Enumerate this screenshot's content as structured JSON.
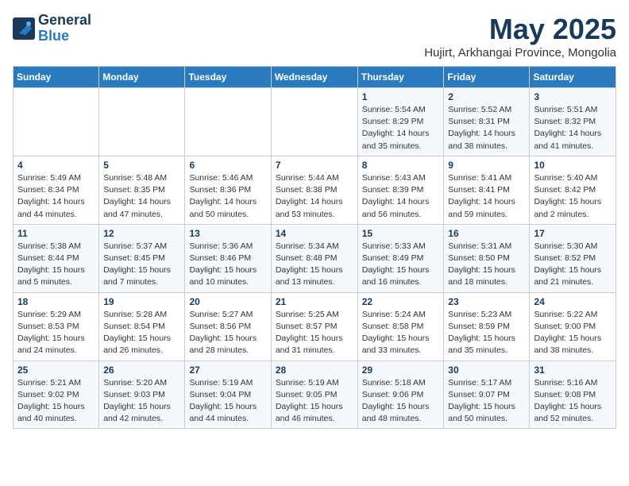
{
  "header": {
    "logo_line1": "General",
    "logo_line2": "Blue",
    "month": "May 2025",
    "location": "Hujirt, Arkhangai Province, Mongolia"
  },
  "weekdays": [
    "Sunday",
    "Monday",
    "Tuesday",
    "Wednesday",
    "Thursday",
    "Friday",
    "Saturday"
  ],
  "weeks": [
    [
      {
        "day": "",
        "info": ""
      },
      {
        "day": "",
        "info": ""
      },
      {
        "day": "",
        "info": ""
      },
      {
        "day": "",
        "info": ""
      },
      {
        "day": "1",
        "info": "Sunrise: 5:54 AM\nSunset: 8:29 PM\nDaylight: 14 hours\nand 35 minutes."
      },
      {
        "day": "2",
        "info": "Sunrise: 5:52 AM\nSunset: 8:31 PM\nDaylight: 14 hours\nand 38 minutes."
      },
      {
        "day": "3",
        "info": "Sunrise: 5:51 AM\nSunset: 8:32 PM\nDaylight: 14 hours\nand 41 minutes."
      }
    ],
    [
      {
        "day": "4",
        "info": "Sunrise: 5:49 AM\nSunset: 8:34 PM\nDaylight: 14 hours\nand 44 minutes."
      },
      {
        "day": "5",
        "info": "Sunrise: 5:48 AM\nSunset: 8:35 PM\nDaylight: 14 hours\nand 47 minutes."
      },
      {
        "day": "6",
        "info": "Sunrise: 5:46 AM\nSunset: 8:36 PM\nDaylight: 14 hours\nand 50 minutes."
      },
      {
        "day": "7",
        "info": "Sunrise: 5:44 AM\nSunset: 8:38 PM\nDaylight: 14 hours\nand 53 minutes."
      },
      {
        "day": "8",
        "info": "Sunrise: 5:43 AM\nSunset: 8:39 PM\nDaylight: 14 hours\nand 56 minutes."
      },
      {
        "day": "9",
        "info": "Sunrise: 5:41 AM\nSunset: 8:41 PM\nDaylight: 14 hours\nand 59 minutes."
      },
      {
        "day": "10",
        "info": "Sunrise: 5:40 AM\nSunset: 8:42 PM\nDaylight: 15 hours\nand 2 minutes."
      }
    ],
    [
      {
        "day": "11",
        "info": "Sunrise: 5:38 AM\nSunset: 8:44 PM\nDaylight: 15 hours\nand 5 minutes."
      },
      {
        "day": "12",
        "info": "Sunrise: 5:37 AM\nSunset: 8:45 PM\nDaylight: 15 hours\nand 7 minutes."
      },
      {
        "day": "13",
        "info": "Sunrise: 5:36 AM\nSunset: 8:46 PM\nDaylight: 15 hours\nand 10 minutes."
      },
      {
        "day": "14",
        "info": "Sunrise: 5:34 AM\nSunset: 8:48 PM\nDaylight: 15 hours\nand 13 minutes."
      },
      {
        "day": "15",
        "info": "Sunrise: 5:33 AM\nSunset: 8:49 PM\nDaylight: 15 hours\nand 16 minutes."
      },
      {
        "day": "16",
        "info": "Sunrise: 5:31 AM\nSunset: 8:50 PM\nDaylight: 15 hours\nand 18 minutes."
      },
      {
        "day": "17",
        "info": "Sunrise: 5:30 AM\nSunset: 8:52 PM\nDaylight: 15 hours\nand 21 minutes."
      }
    ],
    [
      {
        "day": "18",
        "info": "Sunrise: 5:29 AM\nSunset: 8:53 PM\nDaylight: 15 hours\nand 24 minutes."
      },
      {
        "day": "19",
        "info": "Sunrise: 5:28 AM\nSunset: 8:54 PM\nDaylight: 15 hours\nand 26 minutes."
      },
      {
        "day": "20",
        "info": "Sunrise: 5:27 AM\nSunset: 8:56 PM\nDaylight: 15 hours\nand 28 minutes."
      },
      {
        "day": "21",
        "info": "Sunrise: 5:25 AM\nSunset: 8:57 PM\nDaylight: 15 hours\nand 31 minutes."
      },
      {
        "day": "22",
        "info": "Sunrise: 5:24 AM\nSunset: 8:58 PM\nDaylight: 15 hours\nand 33 minutes."
      },
      {
        "day": "23",
        "info": "Sunrise: 5:23 AM\nSunset: 8:59 PM\nDaylight: 15 hours\nand 35 minutes."
      },
      {
        "day": "24",
        "info": "Sunrise: 5:22 AM\nSunset: 9:00 PM\nDaylight: 15 hours\nand 38 minutes."
      }
    ],
    [
      {
        "day": "25",
        "info": "Sunrise: 5:21 AM\nSunset: 9:02 PM\nDaylight: 15 hours\nand 40 minutes."
      },
      {
        "day": "26",
        "info": "Sunrise: 5:20 AM\nSunset: 9:03 PM\nDaylight: 15 hours\nand 42 minutes."
      },
      {
        "day": "27",
        "info": "Sunrise: 5:19 AM\nSunset: 9:04 PM\nDaylight: 15 hours\nand 44 minutes."
      },
      {
        "day": "28",
        "info": "Sunrise: 5:19 AM\nSunset: 9:05 PM\nDaylight: 15 hours\nand 46 minutes."
      },
      {
        "day": "29",
        "info": "Sunrise: 5:18 AM\nSunset: 9:06 PM\nDaylight: 15 hours\nand 48 minutes."
      },
      {
        "day": "30",
        "info": "Sunrise: 5:17 AM\nSunset: 9:07 PM\nDaylight: 15 hours\nand 50 minutes."
      },
      {
        "day": "31",
        "info": "Sunrise: 5:16 AM\nSunset: 9:08 PM\nDaylight: 15 hours\nand 52 minutes."
      }
    ]
  ]
}
